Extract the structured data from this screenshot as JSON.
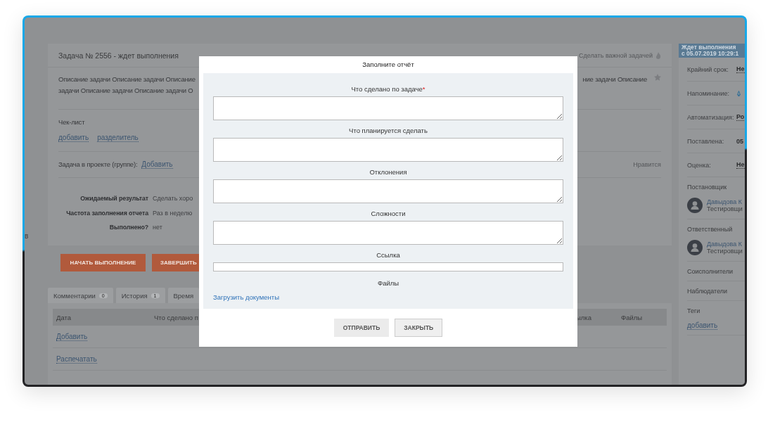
{
  "task": {
    "title": "Задача № 2556 - ждет выполнения",
    "important_action": "Сделать важной задачей",
    "description": [
      "Описание задачи Описание задачи Описание",
      "задачи Описание задачи Описание задачи О"
    ],
    "description_right": "ние задачи Описание",
    "checklist": {
      "label": "Чек-лист",
      "links": [
        "добавить",
        "разделитель"
      ]
    },
    "project": {
      "label": "Задача в проекте (группе):",
      "link": "Добавить"
    },
    "like": "Нравится",
    "fields": [
      {
        "label": "Ожидаемый результат",
        "value": "Сделать хоро"
      },
      {
        "label": "Частота заполнения отчета",
        "value": "Раз в неделю"
      },
      {
        "label": "Выполнено?",
        "value": "нет"
      }
    ],
    "buttons": [
      "НАЧАТЬ ВЫПОЛНЕНИЕ",
      "ЗАВЕРШИТЬ"
    ]
  },
  "tabs": [
    {
      "label": "Комментарии",
      "count": "0"
    },
    {
      "label": "История",
      "count": "1"
    },
    {
      "label": "Время"
    }
  ],
  "table": {
    "columns": [
      "Дата",
      "Что сделано п",
      "ылка",
      "Файлы"
    ],
    "rows": [
      "Добавить",
      "Распечатать"
    ]
  },
  "edge_text": "в",
  "sidebar": {
    "status": [
      "Ждет выполнения",
      "с 05.07.2019 10:29:1"
    ],
    "props": [
      {
        "label": "Крайний срок:",
        "kind": "link",
        "value": "Не"
      },
      {
        "label": "Напоминание:",
        "kind": "bell"
      },
      {
        "label": "Автоматизация:",
        "kind": "link",
        "value": "Ро"
      },
      {
        "label": "Поставлена:",
        "kind": "text",
        "value": "05"
      },
      {
        "label": "Оценка:",
        "kind": "link",
        "value": "Не"
      }
    ],
    "sections": [
      {
        "kind": "person",
        "title": "Постановщик",
        "name": "Давыдова К",
        "role": "Тестировщи"
      },
      {
        "kind": "person",
        "title": "Ответственный",
        "name": "Давыдова К",
        "role": "Тестировщи"
      },
      {
        "kind": "plain",
        "title": "Соисполнители"
      },
      {
        "kind": "plain",
        "title": "Наблюдатели"
      },
      {
        "kind": "tags",
        "title": "Теги",
        "link": "добавить"
      }
    ]
  },
  "modal": {
    "title": "Заполните отчёт",
    "fields": [
      {
        "label": "Что сделано по задаче",
        "mark": "*",
        "kind": "textarea"
      },
      {
        "label": "Что планируется сделать",
        "kind": "textarea"
      },
      {
        "label": "Отклонения",
        "kind": "textarea"
      },
      {
        "label": "Сложности",
        "kind": "textarea"
      },
      {
        "label": "Ссылка",
        "kind": "input"
      }
    ],
    "files_label": "Файлы",
    "upload_link": "Загрузить документы",
    "buttons": [
      {
        "label": "ОТПРАВИТЬ",
        "kind": "primary"
      },
      {
        "label": "ЗАКРЫТЬ",
        "kind": "secondary"
      }
    ]
  }
}
